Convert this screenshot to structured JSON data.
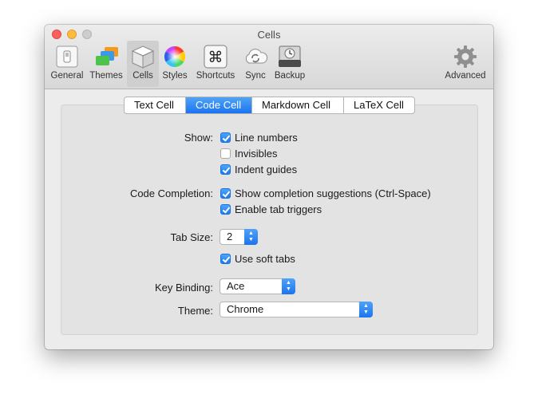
{
  "window": {
    "title": "Cells"
  },
  "toolbar": {
    "items": [
      {
        "label": "General",
        "icon": "general-icon"
      },
      {
        "label": "Themes",
        "icon": "themes-icon"
      },
      {
        "label": "Cells",
        "icon": "cells-icon",
        "selected": true
      },
      {
        "label": "Styles",
        "icon": "styles-icon"
      },
      {
        "label": "Shortcuts",
        "icon": "shortcuts-icon"
      },
      {
        "label": "Sync",
        "icon": "sync-icon"
      },
      {
        "label": "Backup",
        "icon": "backup-icon"
      },
      {
        "label": "Advanced",
        "icon": "gear-icon"
      }
    ]
  },
  "tabs": [
    {
      "label": "Text Cell",
      "active": false
    },
    {
      "label": "Code Cell",
      "active": true
    },
    {
      "label": "Markdown Cell",
      "active": false
    },
    {
      "label": "LaTeX Cell",
      "active": false
    }
  ],
  "form": {
    "show_label": "Show:",
    "line_numbers": {
      "label": "Line numbers",
      "checked": true
    },
    "invisibles": {
      "label": "Invisibles",
      "checked": false
    },
    "indent_guides": {
      "label": "Indent guides",
      "checked": true
    },
    "code_completion_label": "Code Completion:",
    "show_completion": {
      "label": "Show completion suggestions (Ctrl-Space)",
      "checked": true
    },
    "tab_triggers": {
      "label": "Enable tab triggers",
      "checked": true
    },
    "tab_size_label": "Tab Size:",
    "tab_size_value": "2",
    "soft_tabs": {
      "label": "Use soft tabs",
      "checked": true
    },
    "key_binding_label": "Key Binding:",
    "key_binding_value": "Ace",
    "theme_label": "Theme:",
    "theme_value": "Chrome"
  },
  "colors": {
    "accent": "#1b74f0",
    "close": "#fc605c",
    "minimize": "#fdbc40"
  }
}
